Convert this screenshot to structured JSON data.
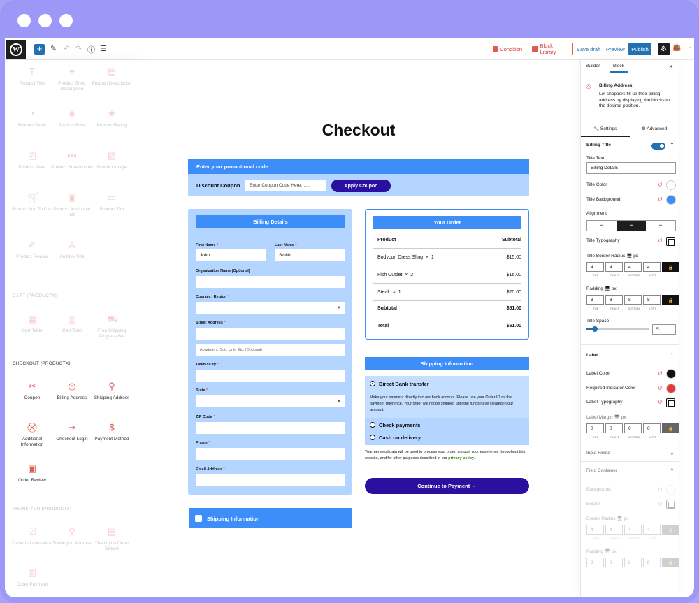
{
  "toolbar": {
    "condition": "Condition",
    "block_library": "Block Library",
    "save_draft": "Save draft",
    "preview": "Preview",
    "publish": "Publish"
  },
  "left_panel": {
    "product_blocks": [
      "Product Title",
      "Product Short Description",
      "Product Description",
      "Product Stock",
      "Product Price",
      "Product Rating",
      "Product Meta",
      "Product Breadcrumb",
      "Product Image",
      "Product Add To Cart",
      "Product Additional Info",
      "Product Tab",
      "Product Review",
      "Archive Title"
    ],
    "cart_section": "CART (PRODUCTX)",
    "cart_blocks": [
      "Cart Table",
      "Cart Total",
      "Free Shipping Progress Bar"
    ],
    "checkout_section": "CHECKOUT (PRODUCTX)",
    "checkout_blocks": [
      "Coupon",
      "Billing Address",
      "Shipping Address",
      "Additional Information",
      "Checkout Login",
      "Payment Method",
      "Order Review"
    ],
    "thankyou_section": "THANK YOU (PRODUCTX)",
    "thankyou_blocks": [
      "Order Conformation",
      "Thank you Address",
      "Thank you Order Details",
      "Order Payment"
    ]
  },
  "checkout": {
    "title": "Checkout",
    "promo": {
      "header": "Enter your promotional code",
      "label": "Discount Coupon",
      "placeholder": "Enter Coupon Code Here……",
      "button": "Apply Coupon"
    },
    "billing": {
      "header": "Billing Details",
      "first_name_label": "First Name",
      "first_name": "John",
      "last_name_label": "Last Name",
      "last_name": "Smith",
      "org_label": "Organization Name (Optional)",
      "country_label": "Country / Region",
      "street_label": "Street Address",
      "apt_placeholder": "Apartment, Suit, Unit, Etc. (Optional)",
      "town_label": "Town / City",
      "state_label": "State",
      "zip_label": "ZIP Code",
      "phone_label": "Phone",
      "email_label": "Email Address",
      "required_mark": "*"
    },
    "shipping_toggle": "Shipping Information",
    "order": {
      "header": "Your Order",
      "col_product": "Product",
      "col_subtotal": "Subtotal",
      "items": [
        {
          "name": "Bodycon Dress Sling",
          "qty": "1",
          "price": "$15.00"
        },
        {
          "name": "Fish Cuttlet",
          "qty": "2",
          "price": "$16.00"
        },
        {
          "name": "Steak",
          "qty": "1",
          "price": "$20.00"
        }
      ],
      "times": "×",
      "subtotal_label": "Subtotal",
      "subtotal": "$51.00",
      "total_label": "Total",
      "total": "$51.00"
    },
    "shipping_info_header": "Shipping Information",
    "payment": {
      "methods": [
        "Direct Bank transfer",
        "Check payments",
        "Cash on delivery"
      ],
      "selected": "Direct Bank transfer",
      "description": "Make your payment directly into our bank account. Please use your Order ID as the payment reference. Your order will not be shipped until the funds have cleared in our account."
    },
    "privacy_text": "Your personal data will be used to process your order, support your experience throughout this website, and for other purposes described in our",
    "privacy_link": "privacy policy",
    "privacy_end": ".",
    "continue_button": "Continue to Payment →"
  },
  "right_panel": {
    "tabs": [
      "Builder",
      "Block"
    ],
    "block_name": "Billing Address",
    "block_desc": "Let shoppers fill up their billing address by displaying the blocks to the desired position.",
    "subtabs": [
      "Settings",
      "Advanced"
    ],
    "billing_title": "Billing Title",
    "title_text_label": "Title Text",
    "title_text": "Billing Details",
    "title_color": "Title Color",
    "title_background": "Title Background",
    "alignment": "Alignment",
    "title_typography": "Title Typography",
    "title_border_radius": "Title Border Radius",
    "px": "px",
    "radius_values": [
      "4",
      "4",
      "4",
      "4"
    ],
    "padding_label": "Padding",
    "padding_values": [
      "8",
      "8",
      "8",
      "8"
    ],
    "dim_labels": [
      "TOP",
      "RIGHT",
      "BOTTOM",
      "LEFT"
    ],
    "title_space": "Title Space",
    "title_space_value": "5",
    "label_section": "Label",
    "label_color": "Label Color",
    "required_color": "Required Indicator Color",
    "label_typography": "Label Typography",
    "label_margin": "Label Margin",
    "margin_values": [
      "0",
      "0",
      "0",
      "0"
    ],
    "input_fields": "Input Fields",
    "field_container": "Field Container",
    "background": "Background",
    "border": "Border",
    "border_radius": "Border Radius",
    "border_radius_values": [
      "4",
      "4",
      "4",
      "4"
    ],
    "padding2": "Padding",
    "padding2_values": [
      "8",
      "8",
      "8",
      "8"
    ]
  },
  "colors": {
    "accent_blue": "#3d8ef8",
    "light_blue": "#b3d5ff",
    "dark_purple": "#2b0f9e",
    "wp_blue": "#2271b1",
    "red": "#e05a4e"
  }
}
